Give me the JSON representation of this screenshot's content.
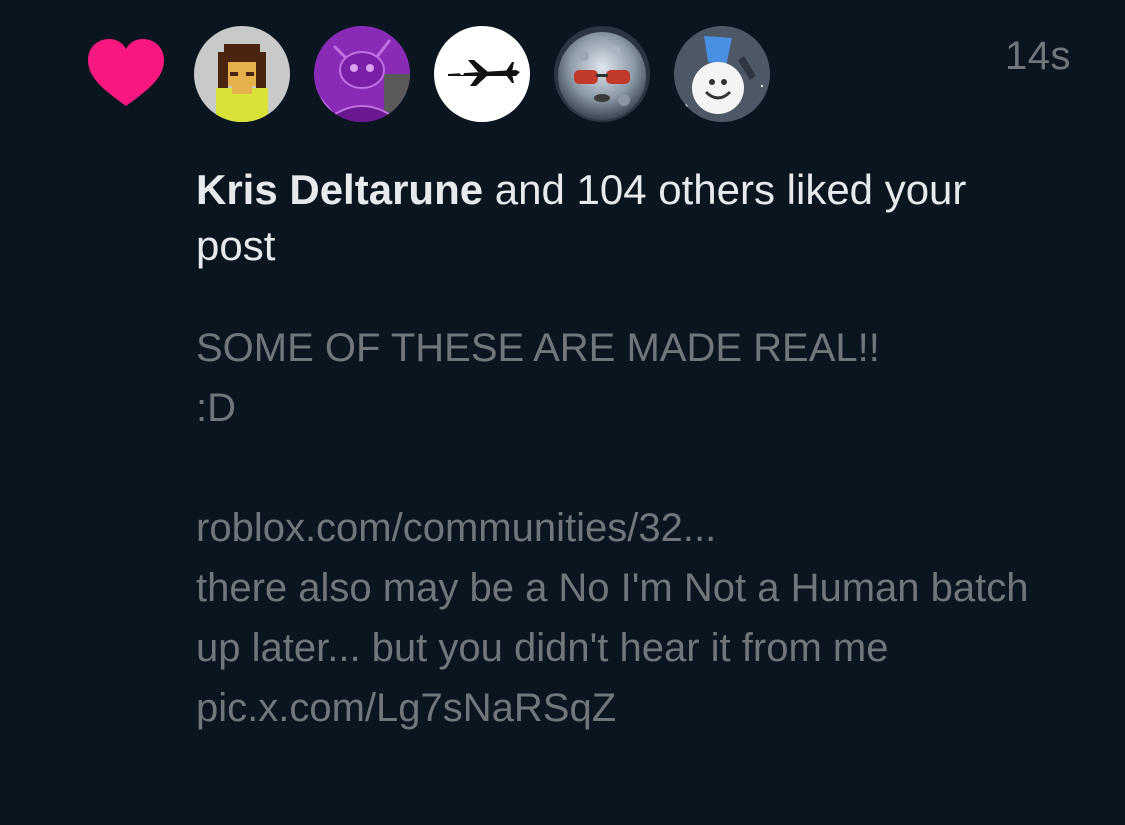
{
  "notification": {
    "timestamp": "14s",
    "liker_name": "Kris Deltarune",
    "action_text": " and 104 others liked your post",
    "post_text": "SOME OF THESE ARE MADE REAL!!\n:D\n\nroblox.com/communities/32...\nthere also may be a No I'm Not a Human batch up later... but you didn't hear it from me\npic.x.com/Lg7sNaRSqZ",
    "avatars": [
      {
        "icon": "pixel-character-avatar"
      },
      {
        "icon": "purple-character-avatar"
      },
      {
        "icon": "airplane-avatar"
      },
      {
        "icon": "moon-face-avatar"
      },
      {
        "icon": "cartoon-character-avatar"
      }
    ]
  },
  "colors": {
    "background": "#0b1520",
    "heart": "#f91880",
    "primary_text": "#e7e9ea",
    "secondary_text": "#71767b"
  }
}
